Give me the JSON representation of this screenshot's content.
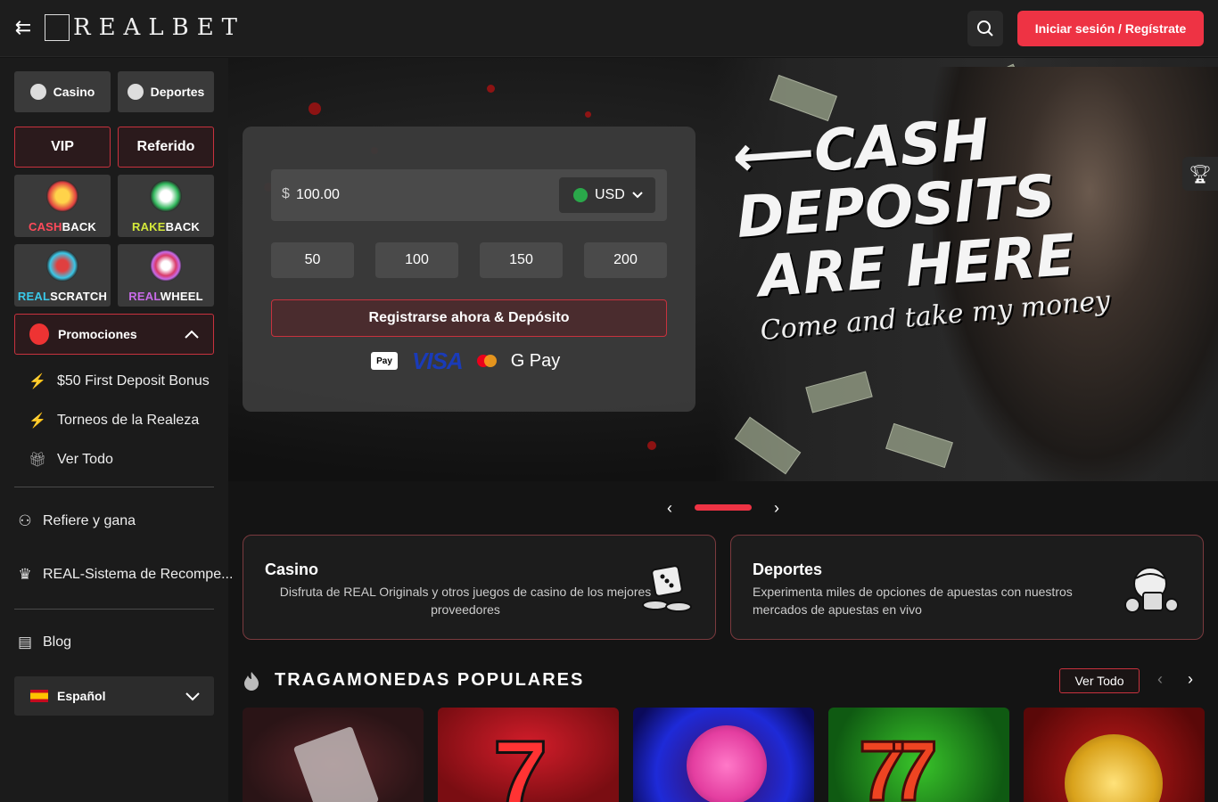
{
  "header": {
    "logo_text": "REALBET",
    "login_label": "Iniciar sesión / Regístrate"
  },
  "sidebar": {
    "tabs": [
      {
        "label": "Casino",
        "icon": "casino-chip-icon"
      },
      {
        "label": "Deportes",
        "icon": "sports-ball-icon"
      }
    ],
    "pills": [
      {
        "label": "VIP"
      },
      {
        "label": "Referido"
      }
    ],
    "features": [
      {
        "prefix": "CASH",
        "suffix": "BACK",
        "prefix_color": "#ff4a5a"
      },
      {
        "prefix": "RAKE",
        "suffix": "BACK",
        "prefix_color": "#d4e83a"
      },
      {
        "prefix": "REAL",
        "suffix": "SCRATCH",
        "prefix_color": "#39c8e8"
      },
      {
        "prefix": "REAL",
        "suffix": "WHEEL",
        "prefix_color": "#c86be8"
      }
    ],
    "promotions": {
      "label": "Promociones",
      "items": [
        {
          "label": "$50 First Deposit Bonus",
          "icon": "lightning-icon"
        },
        {
          "label": "Torneos de la Realeza",
          "icon": "lightning-icon"
        },
        {
          "label": "Ver Todo",
          "icon": "gift-icon"
        }
      ]
    },
    "nav": [
      {
        "label": "Refiere y gana",
        "icon": "referral-tree-icon"
      },
      {
        "label": "REAL-Sistema de Recompe...",
        "icon": "crown-icon"
      },
      {
        "label": "Blog",
        "icon": "blog-icon"
      }
    ],
    "language": "Español"
  },
  "banner": {
    "headline_lines": [
      "CASH",
      "DEPOSITS",
      "ARE HERE"
    ],
    "subline": "Come and take my money",
    "arrow": "⟵"
  },
  "deposit": {
    "currency_sign": "$",
    "amount": "100.00",
    "currency": "USD",
    "quick_amounts": [
      "50",
      "100",
      "150",
      "200"
    ],
    "register_label": "Registrarse ahora & Depósito",
    "payments": {
      "apple": "Pay",
      "visa": "VISA",
      "google": "G Pay"
    }
  },
  "categories": [
    {
      "title": "Casino",
      "desc": "Disfruta de REAL Originals y otros juegos de casino de los mejores proveedores"
    },
    {
      "title": "Deportes",
      "desc": "Experimenta miles de opciones de apuestas con nuestros mercados de apuestas en vivo"
    }
  ],
  "section": {
    "title": "TRAGAMONEDAS POPULARES",
    "view_all": "Ver Todo"
  },
  "colors": {
    "accent": "#ee3344",
    "sidebar_bg": "#1b1b1b",
    "header_bg": "#1d1d1d"
  }
}
